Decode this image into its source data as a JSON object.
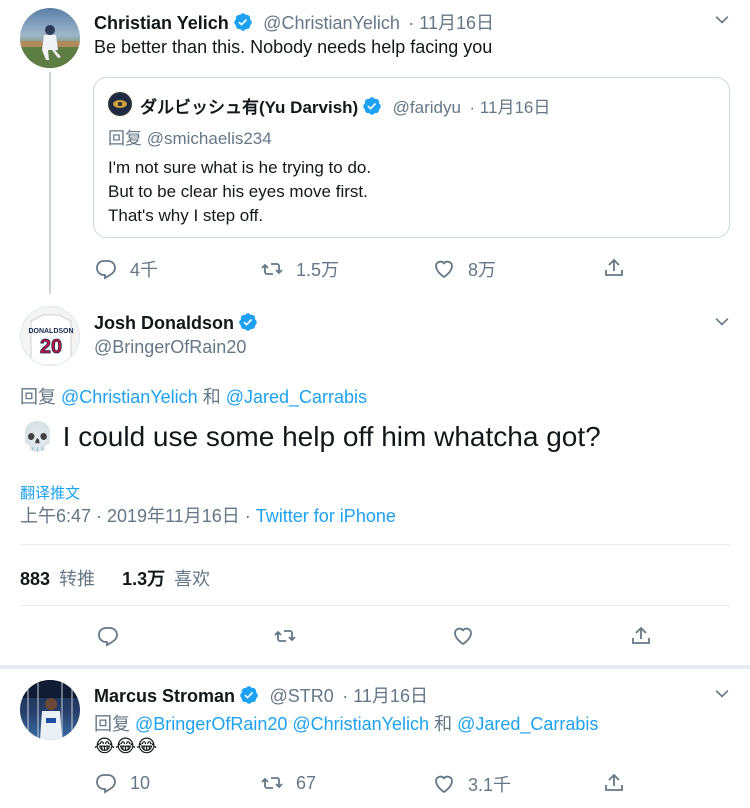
{
  "tweet1": {
    "name": "Christian Yelich",
    "handle": "@ChristianYelich",
    "date": "· 11月16日",
    "text": "Be better than this. Nobody needs help facing you",
    "quote": {
      "name": "ダルビッシュ有(Yu Darvish)",
      "handle": "@faridyu",
      "date": "· 11月16日",
      "reply_prefix": "回复",
      "reply_to": "@smichaelis234",
      "line1": "I'm not sure what is he trying to do.",
      "line2": "But to be clear his eyes move first.",
      "line3": "That's why I step off."
    },
    "replies": "4千",
    "retweets": "1.5万",
    "likes": "8万"
  },
  "tweet2": {
    "name": "Josh Donaldson",
    "handle": "@BringerOfRain20",
    "reply_prefix": "回复",
    "reply_to_1": "@ChristianYelich",
    "reply_and": "和",
    "reply_to_2": "@Jared_Carrabis",
    "emoji": "💀",
    "text": "I could use some help off him whatcha got?",
    "translate": "翻译推文",
    "timestamp": "上午6:47 · 2019年11月16日 ·",
    "source": "Twitter for iPhone",
    "retweet_count": "883",
    "retweet_label": "转推",
    "like_count": "1.3万",
    "like_label": "喜欢"
  },
  "tweet3": {
    "name": "Marcus Stroman",
    "handle": "@STR0",
    "date": "· 11月16日",
    "reply_prefix": "回复",
    "reply_to_1": "@BringerOfRain20",
    "reply_to_2": "@ChristianYelich",
    "reply_and": "和",
    "reply_to_3": "@Jared_Carrabis",
    "text": "😂😂😂",
    "replies": "10",
    "retweets": "67",
    "likes": "3.1千"
  },
  "colors": {
    "accent": "#1da1f2",
    "muted": "#657786",
    "border": "#e6ecf0"
  }
}
